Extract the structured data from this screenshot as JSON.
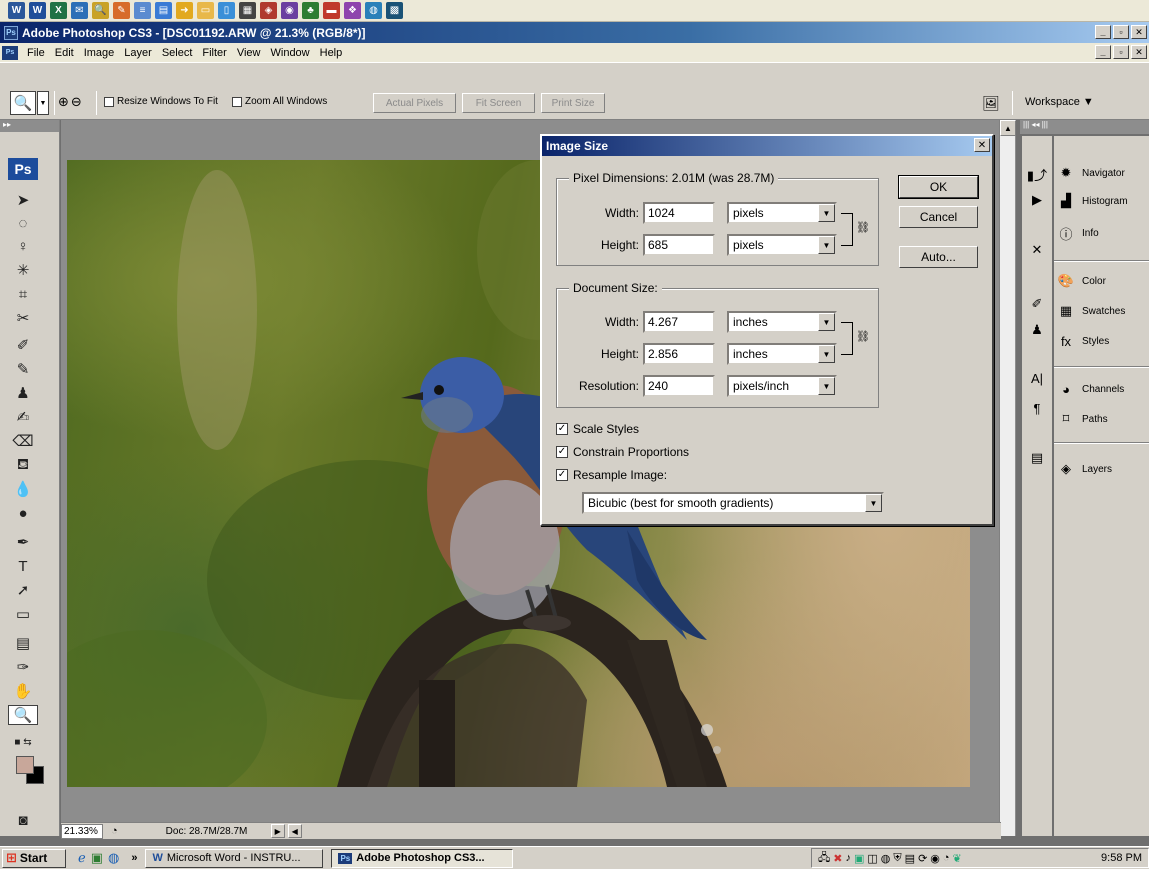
{
  "quicklaunch": {
    "icons": [
      "word-icon",
      "word-doc-icon",
      "excel-icon",
      "outlook-icon",
      "search-tool-icon",
      "paint-icon",
      "notepad-icon",
      "book-icon",
      "arrow-icon",
      "folder-icon",
      "file-icon",
      "calculator-icon",
      "photo-icon",
      "camera-icon",
      "media-icon",
      "game-icon",
      "tray-icon",
      "chart-icon"
    ]
  },
  "window": {
    "title": "Adobe Photoshop CS3 - [DSC01192.ARW @ 21.3% (RGB/8*)]",
    "app_badge": "Ps"
  },
  "menubar": {
    "items": [
      "File",
      "Edit",
      "Image",
      "Layer",
      "Select",
      "Filter",
      "View",
      "Window",
      "Help"
    ]
  },
  "options": {
    "resize_windows": "Resize Windows To Fit",
    "zoom_all": "Zoom All Windows",
    "actual_pixels": "Actual Pixels",
    "fit_screen": "Fit Screen",
    "print_size": "Print Size",
    "workspace": "Workspace ▼"
  },
  "tools": {
    "logo": "Ps"
  },
  "status": {
    "zoom": "21.33%",
    "doc": "Doc: 28.7M/28.7M"
  },
  "palettes": {
    "navigator": "Navigator",
    "histogram": "Histogram",
    "info": "Info",
    "color": "Color",
    "swatches": "Swatches",
    "styles": "Styles",
    "channels": "Channels",
    "paths": "Paths",
    "layers": "Layers"
  },
  "dialog": {
    "title": "Image Size",
    "pixel_dims_label": "Pixel Dimensions:  2.01M (was 28.7M)",
    "width_label": "Width:",
    "height_label": "Height:",
    "px_width": "1024",
    "px_height": "685",
    "px_width_unit": "pixels",
    "px_height_unit": "pixels",
    "doc_size_label": "Document Size:",
    "doc_width": "4.267",
    "doc_height": "2.856",
    "doc_width_unit": "inches",
    "doc_height_unit": "inches",
    "resolution_label": "Resolution:",
    "resolution": "240",
    "resolution_unit": "pixels/inch",
    "ok": "OK",
    "cancel": "Cancel",
    "auto": "Auto...",
    "scale_styles": "Scale Styles",
    "constrain": "Constrain Proportions",
    "resample": "Resample Image:",
    "resample_method": "Bicubic (best for smooth gradients)",
    "scale_styles_checked": true,
    "constrain_checked": true,
    "resample_checked": true
  },
  "taskbar": {
    "start": "Start",
    "chevron": "»",
    "task_word": "Microsoft Word - INSTRU...",
    "task_ps": "Adobe Photoshop CS3...",
    "clock": "9:58 PM"
  }
}
